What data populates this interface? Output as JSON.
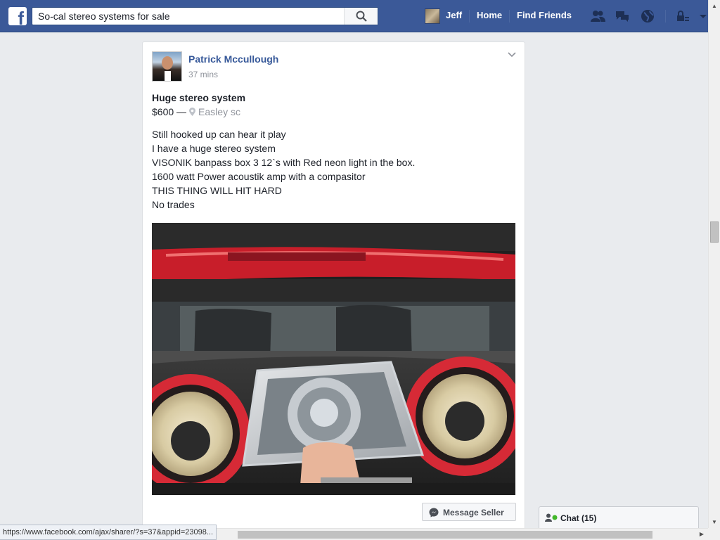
{
  "topbar": {
    "search_value": "So-cal stereo systems for sale",
    "user_name": "Jeff",
    "nav_home": "Home",
    "nav_find_friends": "Find Friends"
  },
  "post": {
    "author": "Patrick Mccullough",
    "time": "37 mins",
    "title": "Huge stereo system",
    "price": "$600 —",
    "location": "Easley sc",
    "description": [
      "Still hooked up can hear it play",
      "I have a huge stereo system",
      "VISONIK banpass box 3 12`s with Red neon light in the box.",
      "1600 watt Power acoustik amp with a compasitor",
      "THIS THING WILL HIT HARD",
      "No trades"
    ],
    "message_button": "Message Seller"
  },
  "chat": {
    "label": "Chat (15)"
  },
  "status_bar": {
    "url": "https://www.facebook.com/ajax/sharer/?s=37&appid=23098..."
  },
  "colors": {
    "brand_blue": "#3b5998",
    "link_blue": "#365899",
    "background": "#e9ebee"
  }
}
